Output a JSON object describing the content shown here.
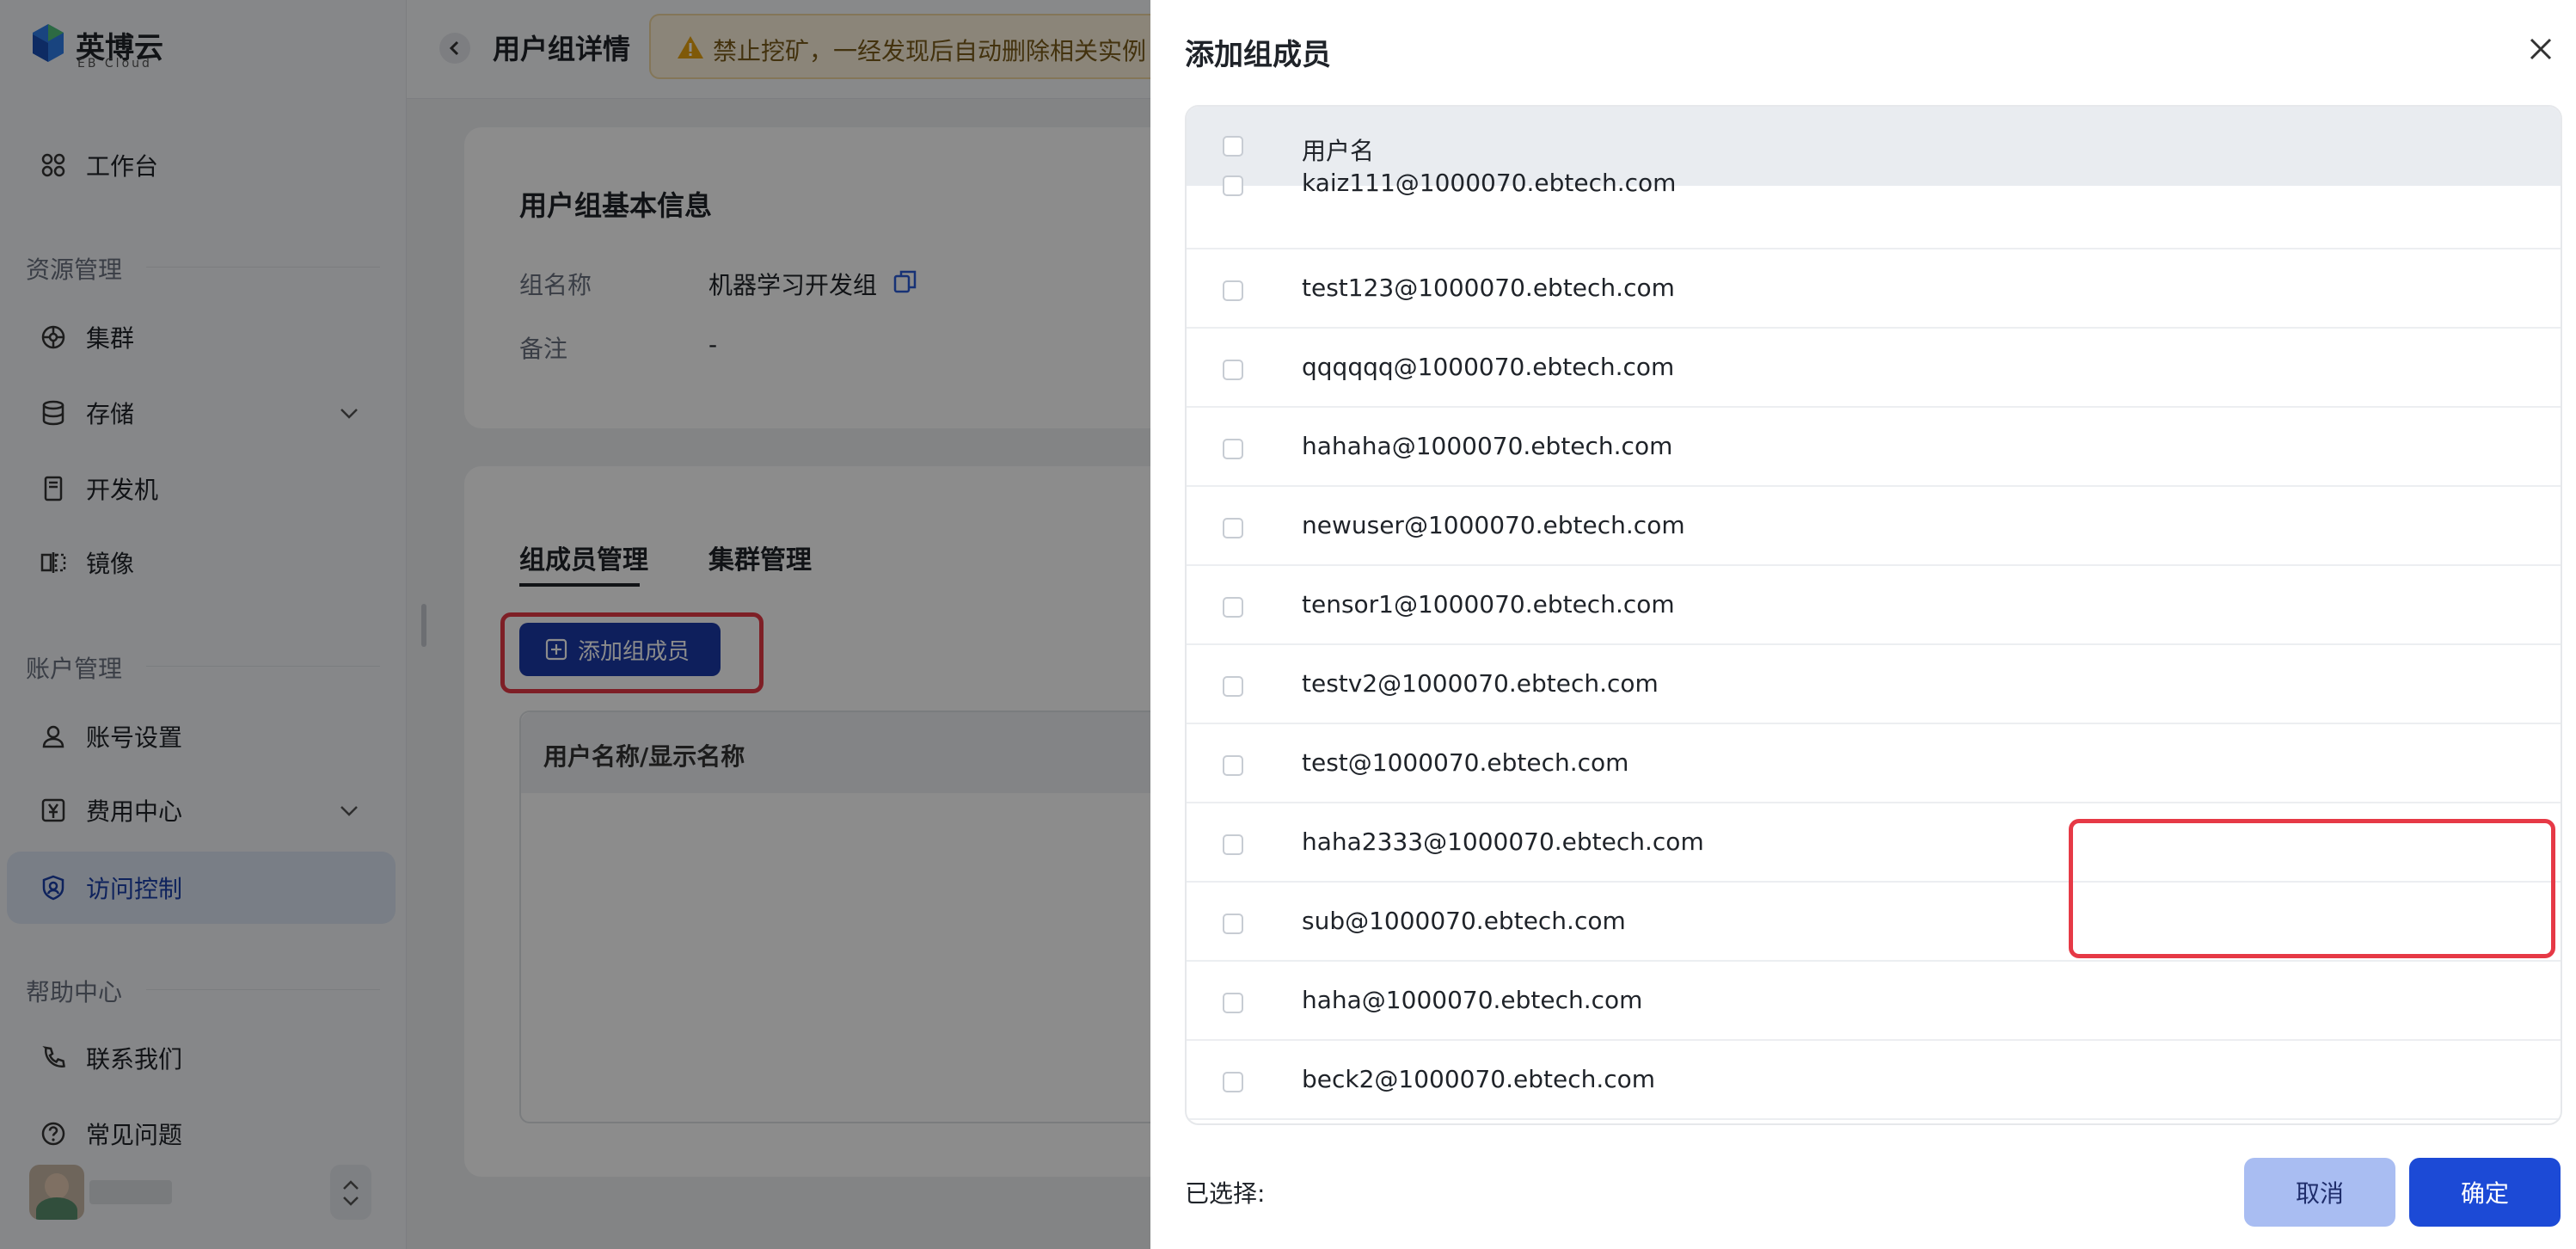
{
  "brand": {
    "name": "英博云",
    "sub": "EB Cloud"
  },
  "sidebar": {
    "workbench": "工作台",
    "sections": [
      {
        "title": "资源管理",
        "items": [
          {
            "label": "集群"
          },
          {
            "label": "存储"
          },
          {
            "label": "开发机"
          },
          {
            "label": "镜像"
          }
        ]
      },
      {
        "title": "账户管理",
        "items": [
          {
            "label": "账号设置"
          },
          {
            "label": "费用中心"
          },
          {
            "label": "访问控制"
          }
        ]
      },
      {
        "title": "帮助中心",
        "items": [
          {
            "label": "联系我们"
          },
          {
            "label": "常见问题"
          }
        ]
      }
    ]
  },
  "header": {
    "title": "用户组详情",
    "warning": "禁止挖矿，一经发现后自动删除相关实例"
  },
  "info": {
    "heading": "用户组基本信息",
    "group_name_key": "组名称",
    "group_name_val": "机器学习开发组",
    "note_key": "备注",
    "note_val": "-"
  },
  "members": {
    "tabs": [
      "组成员管理",
      "集群管理"
    ],
    "add_button": "添加组成员",
    "table_header": "用户名称/显示名称"
  },
  "drawer": {
    "title": "添加组成员",
    "column": "用户名",
    "users": [
      "kaiz111@1000070.ebtech.com",
      "test123@1000070.ebtech.com",
      "qqqqqq@1000070.ebtech.com",
      "hahaha@1000070.ebtech.com",
      "newuser@1000070.ebtech.com",
      "tensor1@1000070.ebtech.com",
      "testv2@1000070.ebtech.com",
      "test@1000070.ebtech.com",
      "haha2333@1000070.ebtech.com",
      "sub@1000070.ebtech.com",
      "haha@1000070.ebtech.com",
      "beck2@1000070.ebtech.com"
    ],
    "selected_label": "已选择:",
    "cancel": "取消",
    "confirm": "确定"
  },
  "colors": {
    "primary": "#1c4ad6",
    "highlight": "#e63946",
    "warning_bg": "#fdf3dd"
  }
}
